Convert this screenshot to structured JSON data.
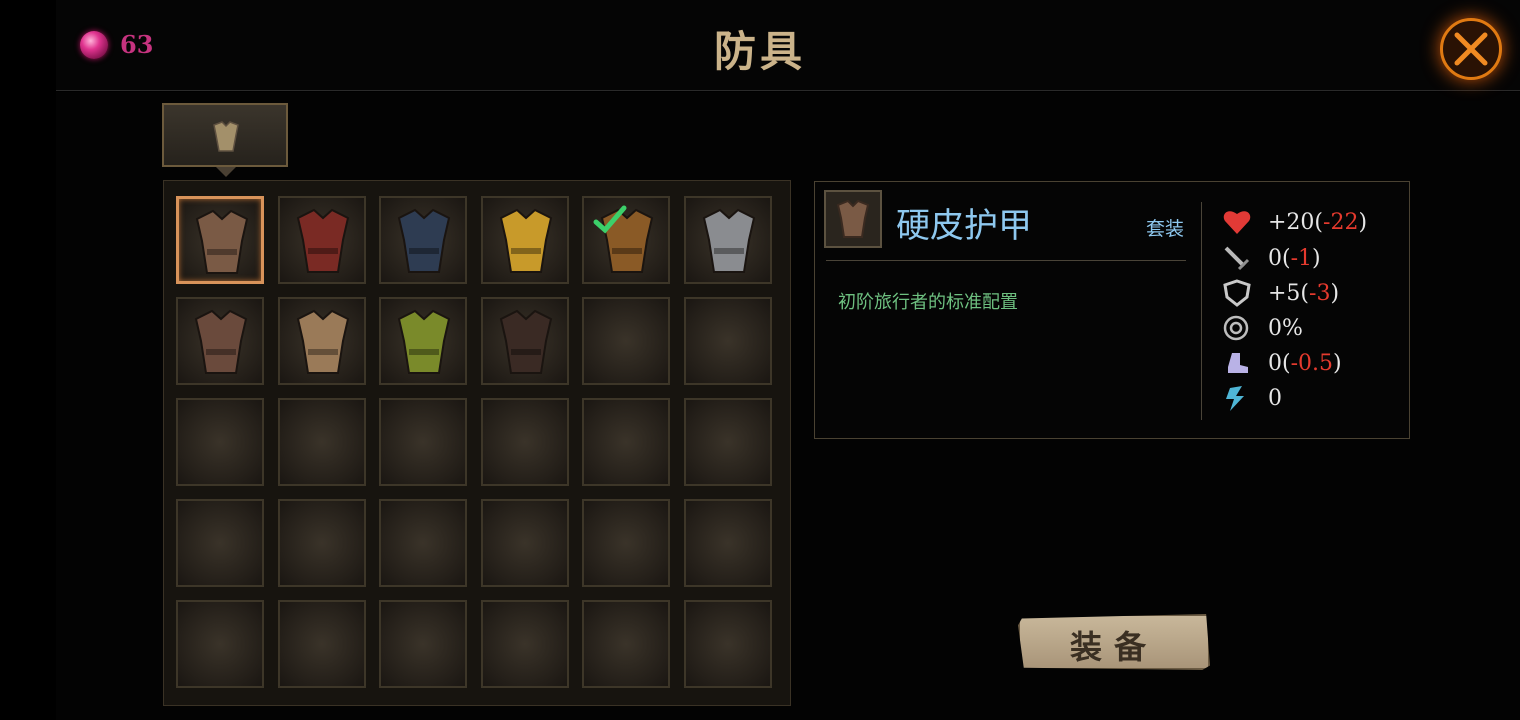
{
  "header": {
    "currency_icon": "pink-gem-icon",
    "currency_count": "63",
    "title": "防具",
    "close_icon": "crossed-swords-close-icon"
  },
  "category_tab": {
    "icon": "armor-chest-icon"
  },
  "inventory": {
    "columns": 6,
    "rows": 5,
    "selected_index": 0,
    "equipped_index": 4,
    "items": [
      {
        "name": "leather-armor",
        "color": "#7a5a45"
      },
      {
        "name": "red-scale-armor",
        "color": "#7a2a24"
      },
      {
        "name": "blue-plate-armor",
        "color": "#2e3c52"
      },
      {
        "name": "golden-blue-armor",
        "color": "#c89a2a"
      },
      {
        "name": "bronze-purple-armor",
        "color": "#8a5a26"
      },
      {
        "name": "steel-plate-armor",
        "color": "#8a8c90"
      },
      {
        "name": "red-skirt-armor",
        "color": "#6a4a3c"
      },
      {
        "name": "brown-white-armor",
        "color": "#9a7a58"
      },
      {
        "name": "green-spiked-armor",
        "color": "#7a8a2a"
      },
      {
        "name": "black-gold-armor",
        "color": "#3a2a24"
      }
    ]
  },
  "detail": {
    "name": "硬皮护甲",
    "set_label": "套装",
    "description": "初阶旅行者的标准配置",
    "stats": [
      {
        "icon": "heart-icon",
        "base": "+20(",
        "delta": "-22",
        "close": ")"
      },
      {
        "icon": "sword-icon",
        "base": "0(",
        "delta": "-1",
        "close": ")"
      },
      {
        "icon": "shield-icon",
        "base": "+5(",
        "delta": "-3",
        "close": ")"
      },
      {
        "icon": "crit-target-icon",
        "base": "0%",
        "delta": "",
        "close": ""
      },
      {
        "icon": "boot-speed-icon",
        "base": "0(",
        "delta": "-0.5",
        "close": ")"
      },
      {
        "icon": "lightning-icon",
        "base": "0",
        "delta": "",
        "close": ""
      }
    ]
  },
  "equip_button": {
    "label": "装备"
  }
}
